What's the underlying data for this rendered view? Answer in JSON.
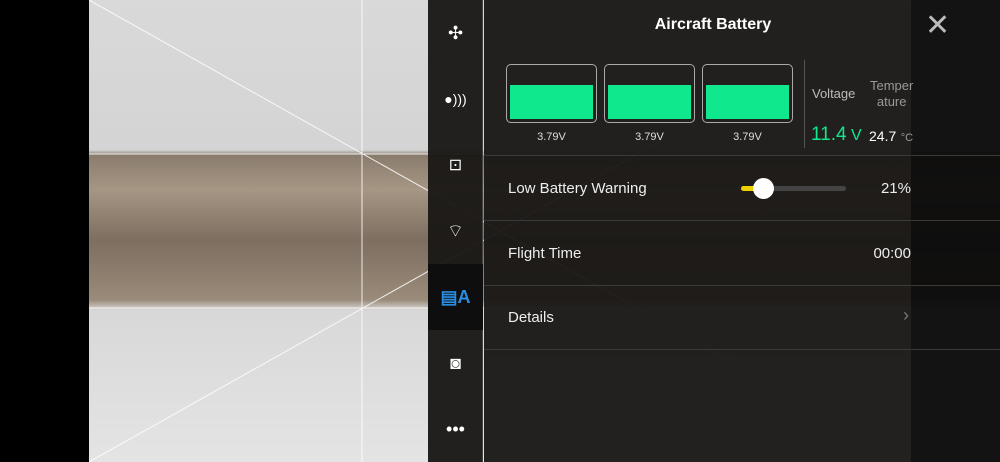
{
  "header": {
    "title": "Aircraft Battery"
  },
  "cells": [
    {
      "voltage": "3.79V",
      "level": 0.6
    },
    {
      "voltage": "3.79V",
      "level": 0.6
    },
    {
      "voltage": "3.79V",
      "level": 0.6
    }
  ],
  "summary": {
    "voltage_label": "Voltage",
    "voltage_value": "11.4",
    "voltage_unit": "V",
    "temp_label_1": "Temper",
    "temp_label_2": "ature",
    "temp_value": "24.7",
    "temp_unit": "°C"
  },
  "settings": {
    "low_battery_label": "Low Battery Warning",
    "low_battery_value": "21%",
    "low_battery_percent": 21,
    "flight_time_label": "Flight Time",
    "flight_time_value": "00:00",
    "details_label": "Details"
  },
  "sidebar": [
    "aircraft",
    "signal",
    "remote-controller",
    "wifi",
    "battery",
    "camera",
    "more"
  ],
  "colors": {
    "accent": "#0fe88c",
    "active": "#2a8de0"
  }
}
